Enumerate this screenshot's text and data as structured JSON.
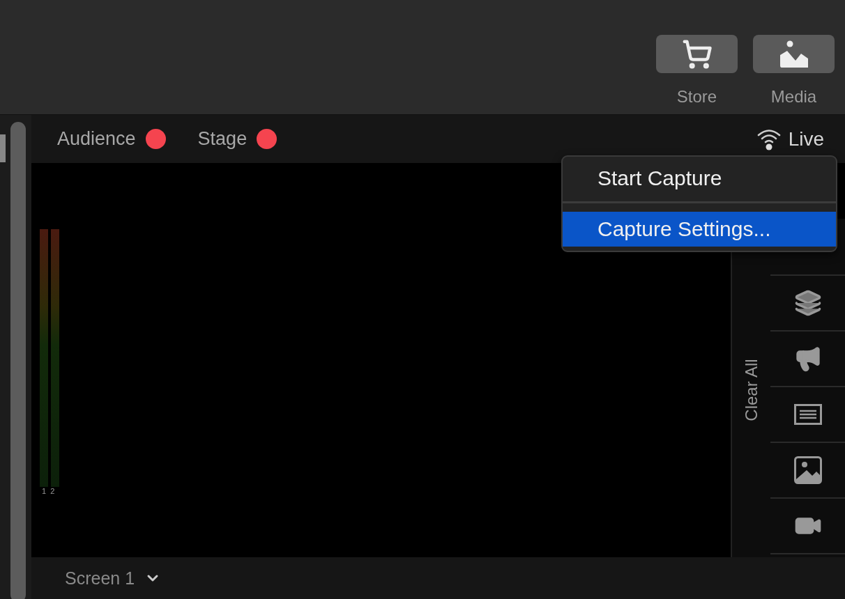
{
  "toolbar": {
    "buttons": [
      {
        "label": "Store",
        "kind": "store"
      },
      {
        "label": "Media",
        "kind": "media"
      }
    ]
  },
  "outputs": [
    {
      "label": "Audience",
      "color": "#f5444f"
    },
    {
      "label": "Stage",
      "color": "#f5444f"
    }
  ],
  "live": {
    "label": "Live"
  },
  "menu": {
    "items": [
      {
        "label": "Start Capture",
        "selected": false
      },
      {
        "label": "Capture Settings...",
        "selected": true
      }
    ]
  },
  "meter": {
    "channels": [
      "1",
      "2"
    ]
  },
  "sidebar": {
    "clear_label": "Clear All",
    "tools": [
      {
        "kind": "layers"
      },
      {
        "kind": "megaphone"
      },
      {
        "kind": "text"
      },
      {
        "kind": "image"
      },
      {
        "kind": "video"
      }
    ]
  },
  "footer": {
    "screen": "Screen 1"
  }
}
